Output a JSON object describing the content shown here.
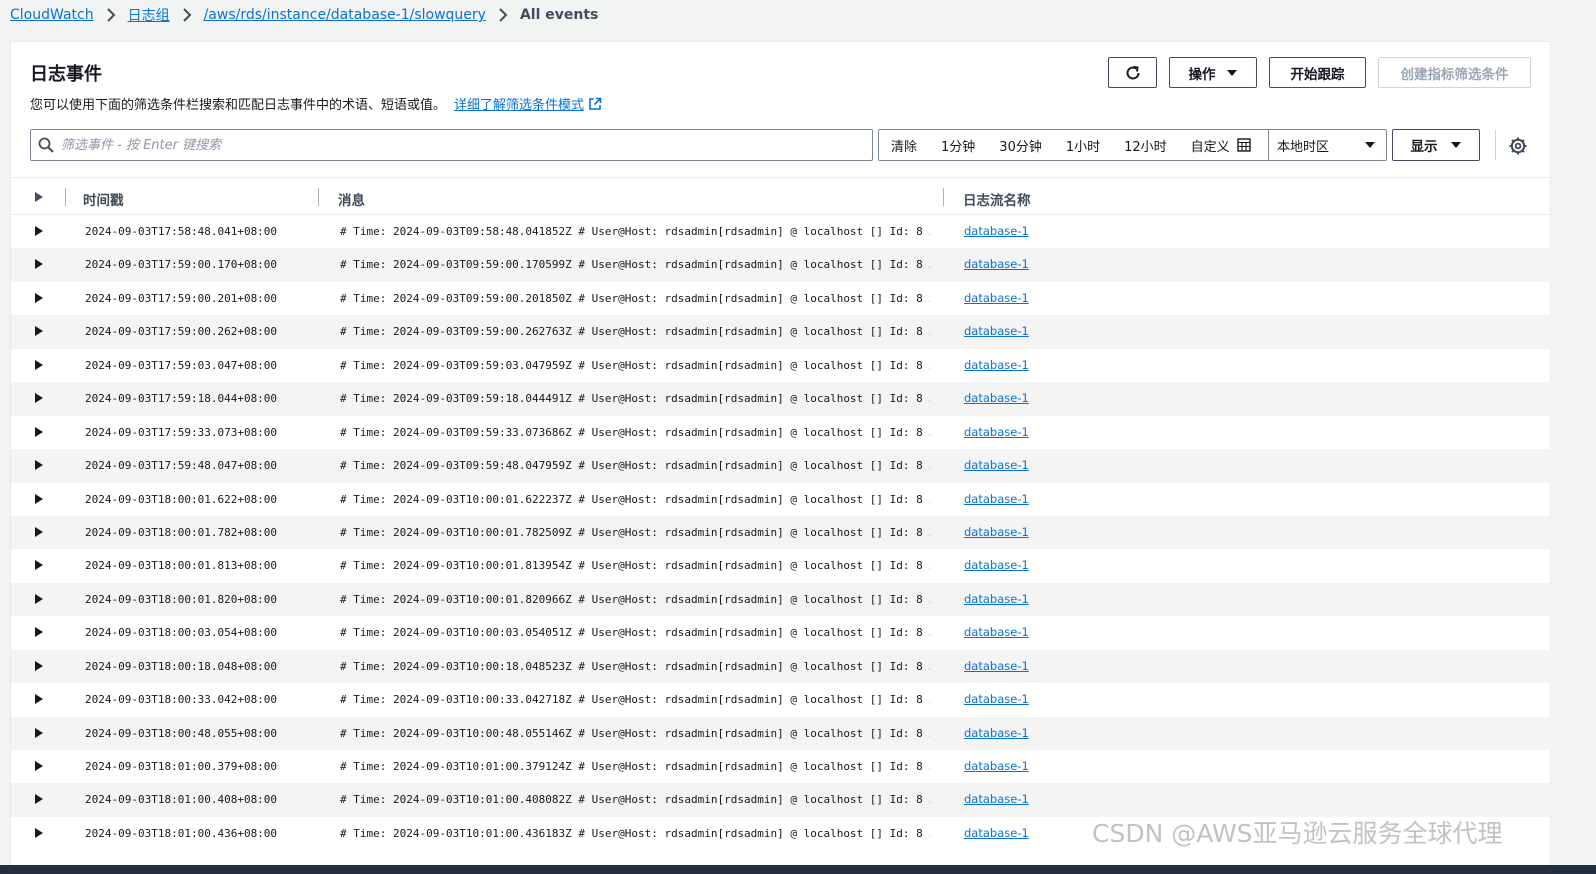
{
  "breadcrumb": {
    "items": [
      "CloudWatch",
      "日志组",
      "/aws/rds/instance/database-1/slowquery"
    ],
    "current": "All events"
  },
  "panel": {
    "title": "日志事件",
    "description": "您可以使用下面的筛选条件栏搜索和匹配日志事件中的术语、短语或值。",
    "learn_more": "详细了解筛选条件模式"
  },
  "toolbar": {
    "actions_label": "操作",
    "start_tail_label": "开始跟踪",
    "create_filter_label": "创建指标筛选条件"
  },
  "filter": {
    "placeholder": "筛选事件 - 按 Enter 键搜索",
    "clear": "清除",
    "ranges": [
      "1分钟",
      "30分钟",
      "1小时",
      "12小时"
    ],
    "custom": "自定义",
    "timezone": "本地时区",
    "display": "显示"
  },
  "table": {
    "columns": [
      "时间戳",
      "消息",
      "日志流名称"
    ],
    "rows": [
      {
        "ts": "2024-09-03T17:58:48.041+08:00",
        "msg": "# Time: 2024-09-03T09:58:48.041852Z # User@Host: rdsadmin[rdsadmin] @ localhost [] Id: 8 …",
        "stream": "database-1"
      },
      {
        "ts": "2024-09-03T17:59:00.170+08:00",
        "msg": "# Time: 2024-09-03T09:59:00.170599Z # User@Host: rdsadmin[rdsadmin] @ localhost [] Id: 8 …",
        "stream": "database-1"
      },
      {
        "ts": "2024-09-03T17:59:00.201+08:00",
        "msg": "# Time: 2024-09-03T09:59:00.201850Z # User@Host: rdsadmin[rdsadmin] @ localhost [] Id: 8 …",
        "stream": "database-1"
      },
      {
        "ts": "2024-09-03T17:59:00.262+08:00",
        "msg": "# Time: 2024-09-03T09:59:00.262763Z # User@Host: rdsadmin[rdsadmin] @ localhost [] Id: 8 …",
        "stream": "database-1"
      },
      {
        "ts": "2024-09-03T17:59:03.047+08:00",
        "msg": "# Time: 2024-09-03T09:59:03.047959Z # User@Host: rdsadmin[rdsadmin] @ localhost [] Id: 8 …",
        "stream": "database-1"
      },
      {
        "ts": "2024-09-03T17:59:18.044+08:00",
        "msg": "# Time: 2024-09-03T09:59:18.044491Z # User@Host: rdsadmin[rdsadmin] @ localhost [] Id: 8 …",
        "stream": "database-1"
      },
      {
        "ts": "2024-09-03T17:59:33.073+08:00",
        "msg": "# Time: 2024-09-03T09:59:33.073686Z # User@Host: rdsadmin[rdsadmin] @ localhost [] Id: 8 …",
        "stream": "database-1"
      },
      {
        "ts": "2024-09-03T17:59:48.047+08:00",
        "msg": "# Time: 2024-09-03T09:59:48.047959Z # User@Host: rdsadmin[rdsadmin] @ localhost [] Id: 8 …",
        "stream": "database-1"
      },
      {
        "ts": "2024-09-03T18:00:01.622+08:00",
        "msg": "# Time: 2024-09-03T10:00:01.622237Z # User@Host: rdsadmin[rdsadmin] @ localhost [] Id: 8 …",
        "stream": "database-1"
      },
      {
        "ts": "2024-09-03T18:00:01.782+08:00",
        "msg": "# Time: 2024-09-03T10:00:01.782509Z # User@Host: rdsadmin[rdsadmin] @ localhost [] Id: 8 …",
        "stream": "database-1"
      },
      {
        "ts": "2024-09-03T18:00:01.813+08:00",
        "msg": "# Time: 2024-09-03T10:00:01.813954Z # User@Host: rdsadmin[rdsadmin] @ localhost [] Id: 8 …",
        "stream": "database-1"
      },
      {
        "ts": "2024-09-03T18:00:01.820+08:00",
        "msg": "# Time: 2024-09-03T10:00:01.820966Z # User@Host: rdsadmin[rdsadmin] @ localhost [] Id: 8 …",
        "stream": "database-1"
      },
      {
        "ts": "2024-09-03T18:00:03.054+08:00",
        "msg": "# Time: 2024-09-03T10:00:03.054051Z # User@Host: rdsadmin[rdsadmin] @ localhost [] Id: 8 …",
        "stream": "database-1"
      },
      {
        "ts": "2024-09-03T18:00:18.048+08:00",
        "msg": "# Time: 2024-09-03T10:00:18.048523Z # User@Host: rdsadmin[rdsadmin] @ localhost [] Id: 8 …",
        "stream": "database-1"
      },
      {
        "ts": "2024-09-03T18:00:33.042+08:00",
        "msg": "# Time: 2024-09-03T10:00:33.042718Z # User@Host: rdsadmin[rdsadmin] @ localhost [] Id: 8 …",
        "stream": "database-1"
      },
      {
        "ts": "2024-09-03T18:00:48.055+08:00",
        "msg": "# Time: 2024-09-03T10:00:48.055146Z # User@Host: rdsadmin[rdsadmin] @ localhost [] Id: 8 …",
        "stream": "database-1"
      },
      {
        "ts": "2024-09-03T18:01:00.379+08:00",
        "msg": "# Time: 2024-09-03T10:01:00.379124Z # User@Host: rdsadmin[rdsadmin] @ localhost [] Id: 8 …",
        "stream": "database-1"
      },
      {
        "ts": "2024-09-03T18:01:00.408+08:00",
        "msg": "# Time: 2024-09-03T10:01:00.408082Z # User@Host: rdsadmin[rdsadmin] @ localhost [] Id: 8 …",
        "stream": "database-1"
      },
      {
        "ts": "2024-09-03T18:01:00.436+08:00",
        "msg": "# Time: 2024-09-03T10:01:00.436183Z # User@Host: rdsadmin[rdsadmin] @ localhost [] Id: 8 …",
        "stream": "database-1"
      }
    ]
  },
  "watermark": "CSDN @AWS亚马逊云服务全球代理"
}
